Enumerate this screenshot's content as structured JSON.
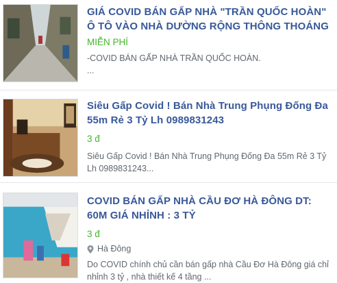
{
  "listings": [
    {
      "title": "GIÁ COVID BÁN GẤP NHÀ \"TRẦN QUỐC HOÀN\" Ô TÔ VÀO NHÀ DƯỜNG RỘNG THÔNG THOÁNG",
      "price": "MIỄN PHÍ",
      "description": "-COVID BÁN GẤP NHÀ TRẦN QUỐC HOÀN.\n..."
    },
    {
      "title": "Siêu Gấp Covid ! Bán Nhà Trung Phụng Đống Đa 55m Rẻ 3 Tỷ Lh 0989831243",
      "price": "3 đ",
      "description": "Siêu Gấp Covid ! Bán Nhà Trung Phụng Đống Đa 55m Rẻ 3 Tỷ Lh 0989831243..."
    },
    {
      "title": "COVID BÁN GẤP NHÀ CẦU ĐƠ HÀ ĐÔNG DT: 60M GIÁ NHỈNH : 3 TỶ",
      "price": "3 đ",
      "location": "Hà Đông",
      "description": "Do COVID chính chủ cần bán gấp nhà Cầu Đơ Hà Đông giá chỉ nhỉnh 3 tỷ , nhà thiết kế 4 tầng ..."
    }
  ],
  "colors": {
    "title": "#385898",
    "price": "#42b72a",
    "meta": "#606770"
  },
  "icons": {
    "location": "map-pin-icon"
  }
}
